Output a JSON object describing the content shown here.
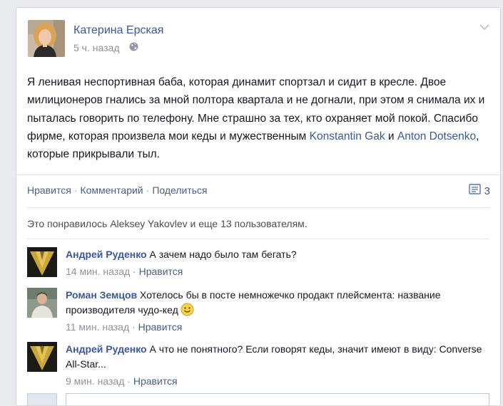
{
  "post": {
    "author": "Катерина Ерская",
    "time": "5 ч. назад",
    "text_part1": "Я ленивая неспортивная баба, которая динамит спортзал и сидит в кресле. Двое милиционеров гнались за мной полтора квартала и не догнали, при этом я снимала их и пыталась говорить по телефону. Мне страшно за тех, кто охраняет мой покой. Спасибо фирме, которая произвела мои кеды и мужественным ",
    "mention1": "Konstantin Gak",
    "text_and": " и ",
    "mention2": "Anton Dotsenko",
    "text_part2": ", которые прикрывали тыл."
  },
  "actions": {
    "like": "Нравится",
    "comment": "Комментарий",
    "share": "Поделиться",
    "dot": "·",
    "comment_count": "3"
  },
  "likes_line": "Это понравилось Aleksey Yakovlev и еще 13 пользователям.",
  "comments": [
    {
      "name": "Андрей Руденко",
      "text": "А зачем надо было там бегать?",
      "time": "14 мин. назад",
      "like": "Нравится"
    },
    {
      "name": "Роман Земцов",
      "text": "Хотелось бы в посте немножечко продакт плейсмента: название производителя чудо-кед",
      "time": "11 мин. назад",
      "like": "Нравится"
    },
    {
      "name": "Андрей Руденко",
      "text": "А что не понятного? Если говорят кеды, значит имеют в виду: Converse All-Star...",
      "time": "9 мин. назад",
      "like": "Нравится"
    }
  ],
  "colors": {
    "link": "#3b5998",
    "meta": "#90949c",
    "background": "#e9eaed"
  },
  "icons": {
    "privacy": "globe-icon",
    "menu": "chevron-down-icon",
    "comments": "comment-bubble-icon",
    "emoji": "smiley-icon"
  }
}
